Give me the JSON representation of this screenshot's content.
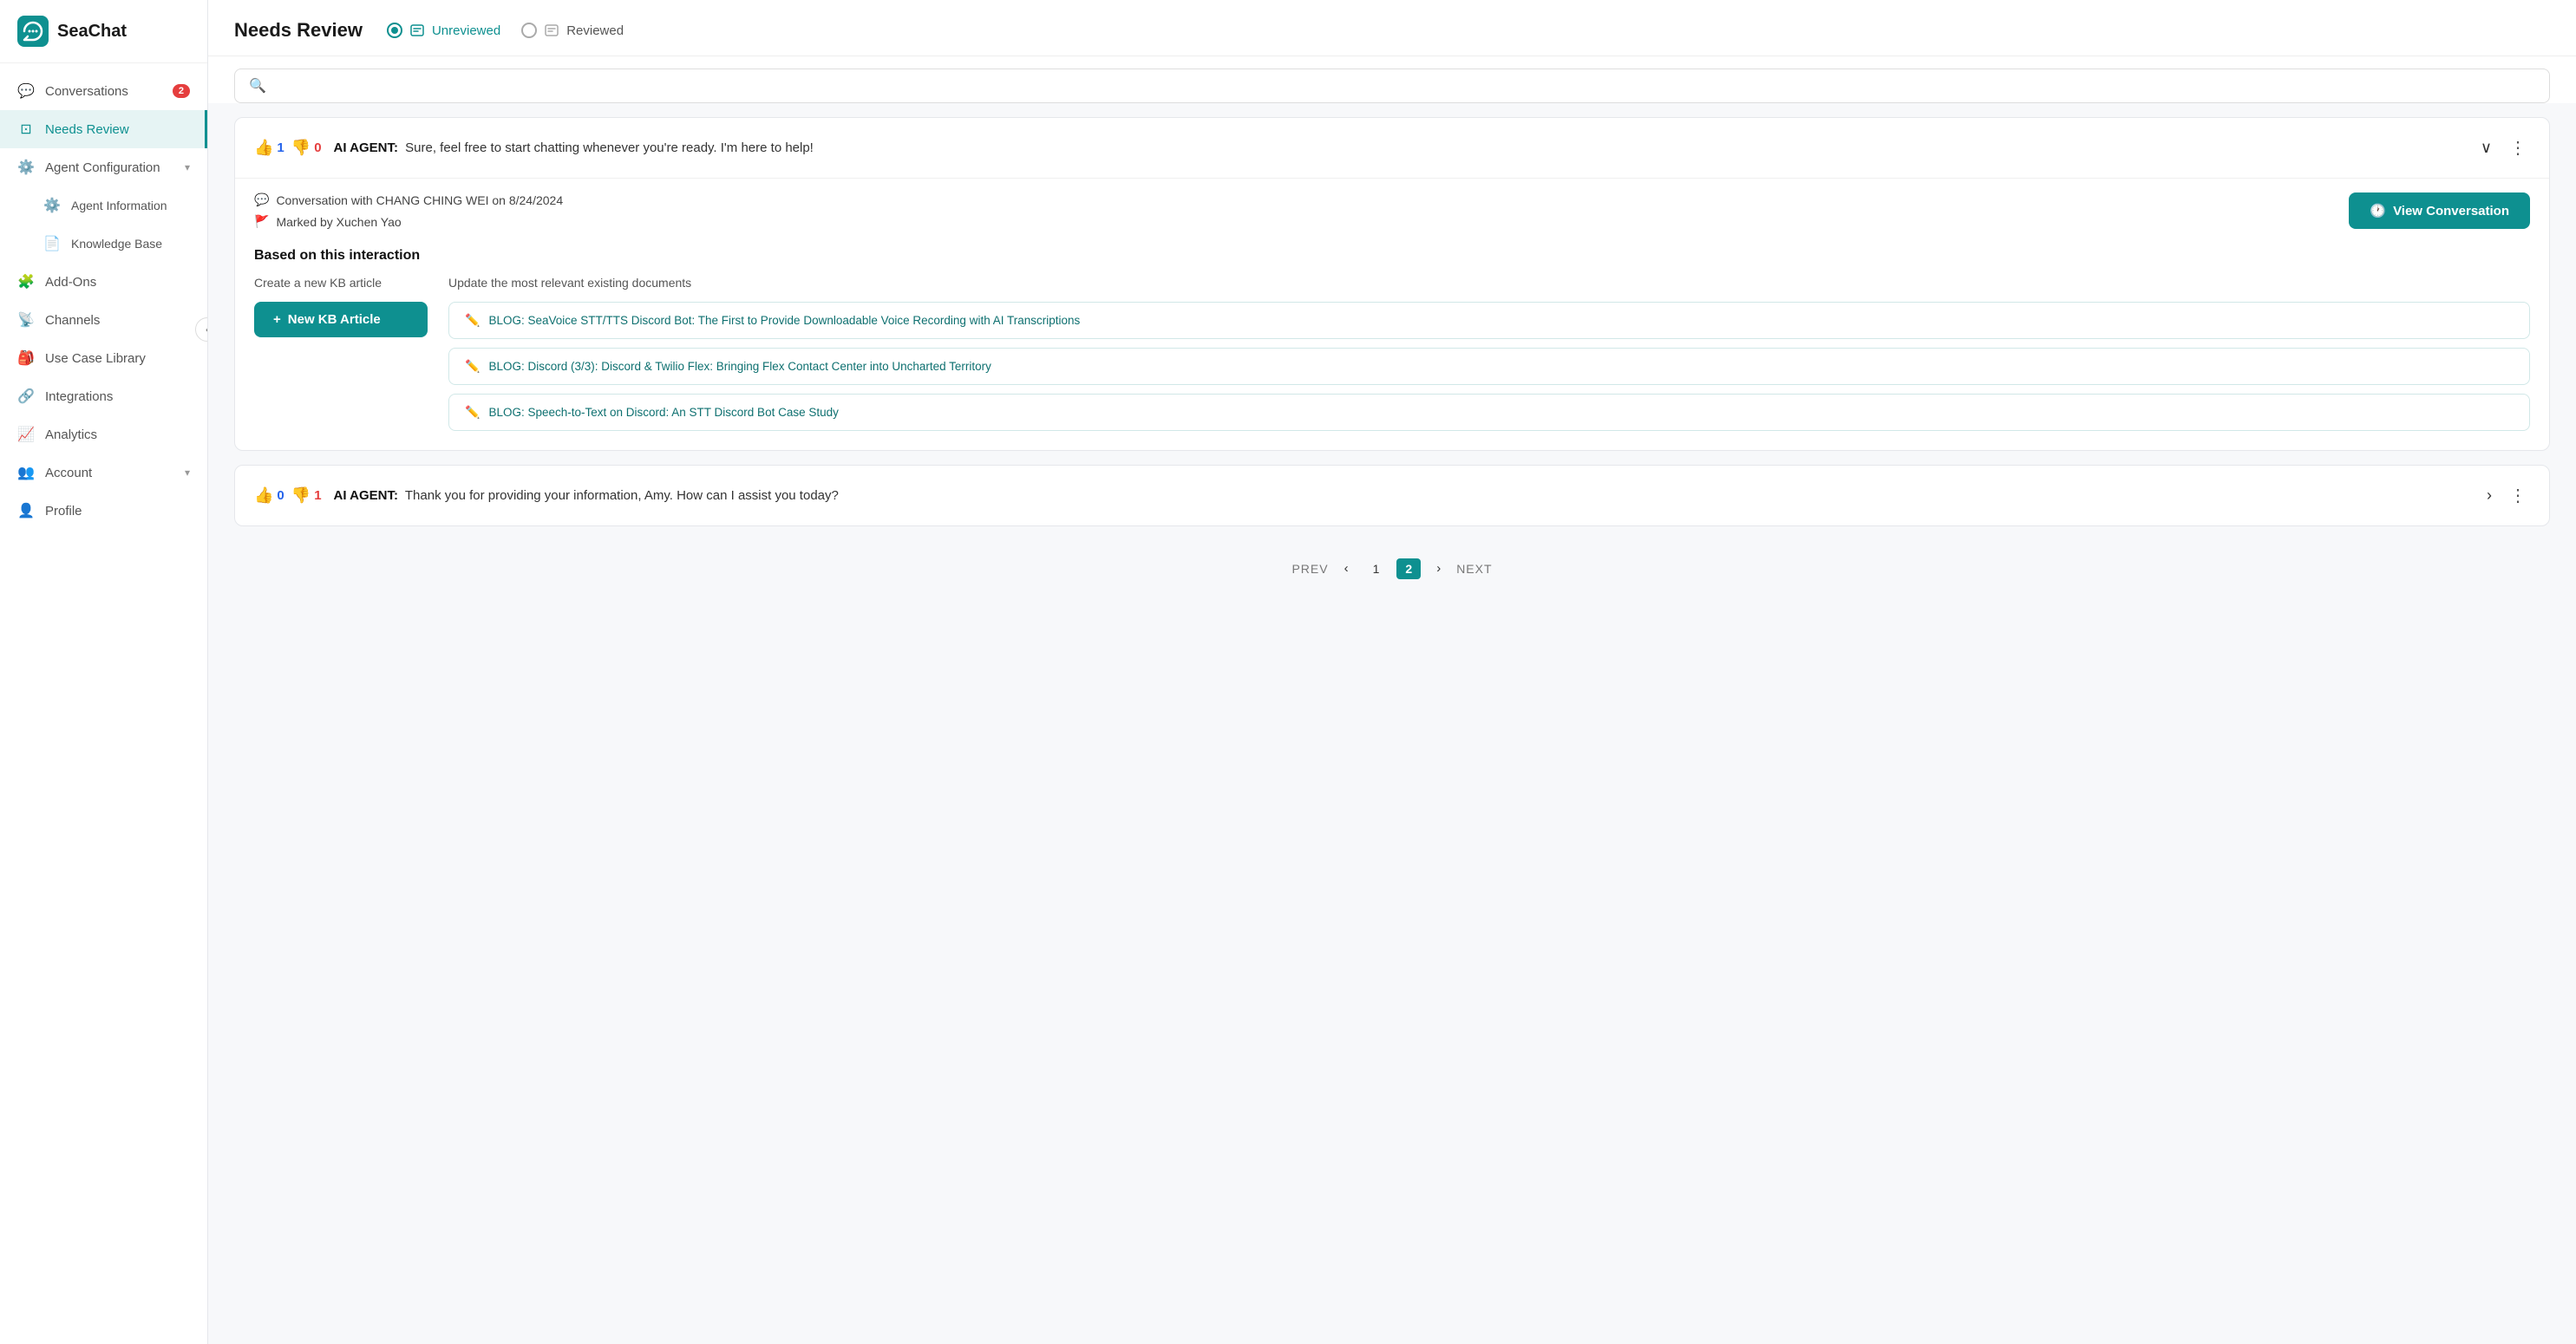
{
  "app": {
    "name": "SeaChat"
  },
  "sidebar": {
    "items": [
      {
        "id": "conversations",
        "label": "Conversations",
        "icon": "💬",
        "badge": "2",
        "active": false
      },
      {
        "id": "needs-review",
        "label": "Needs Review",
        "icon": "📋",
        "badge": null,
        "active": true
      },
      {
        "id": "agent-configuration",
        "label": "Agent Configuration",
        "icon": "⚙️",
        "badge": null,
        "arrow": true,
        "active": false
      },
      {
        "id": "agent-information",
        "label": "Agent Information",
        "icon": "⚙️",
        "badge": null,
        "active": false,
        "sub": true
      },
      {
        "id": "knowledge-base",
        "label": "Knowledge Base",
        "icon": "📄",
        "badge": null,
        "active": false,
        "sub": true
      },
      {
        "id": "add-ons",
        "label": "Add-Ons",
        "icon": "🧩",
        "badge": null,
        "active": false
      },
      {
        "id": "channels",
        "label": "Channels",
        "icon": "📡",
        "badge": null,
        "active": false
      },
      {
        "id": "use-case-library",
        "label": "Use Case Library",
        "icon": "🎒",
        "badge": null,
        "active": false
      },
      {
        "id": "integrations",
        "label": "Integrations",
        "icon": "🔗",
        "badge": null,
        "active": false
      },
      {
        "id": "analytics",
        "label": "Analytics",
        "icon": "📈",
        "badge": null,
        "active": false
      },
      {
        "id": "account",
        "label": "Account",
        "icon": "👥",
        "badge": null,
        "arrow": true,
        "active": false
      },
      {
        "id": "profile",
        "label": "Profile",
        "icon": "👤",
        "badge": null,
        "active": false
      }
    ]
  },
  "header": {
    "title": "Needs Review",
    "tabs": [
      {
        "id": "unreviewed",
        "label": "Unreviewed",
        "active": true,
        "radio": "filled"
      },
      {
        "id": "reviewed",
        "label": "Reviewed",
        "active": false,
        "radio": "empty"
      }
    ]
  },
  "search": {
    "placeholder": ""
  },
  "cards": [
    {
      "id": "card1",
      "thumbUp": "1",
      "thumbDown": "0",
      "agent": "AI AGENT:",
      "message": " Sure, feel free to start chatting whenever you're ready. I'm here to help!",
      "expanded": true,
      "conversation": "Conversation with CHANG CHING WEI on 8/24/2024",
      "markedBy": "Marked by Xuchen Yao",
      "viewBtn": "View Conversation",
      "sectionTitle": "Based on this interaction",
      "createLabel": "Create a new KB article",
      "updateLabel": "Update the most relevant existing documents",
      "newKbBtn": "+ New KB Article",
      "docs": [
        {
          "text": "BLOG: SeaVoice STT/TTS Discord Bot: The First to Provide Downloadable Voice Recording with AI Transcriptions"
        },
        {
          "text": "BLOG: Discord (3/3): Discord & Twilio Flex: Bringing Flex Contact Center into Uncharted Territory"
        },
        {
          "text": "BLOG: Speech-to-Text on Discord: An STT Discord Bot Case Study"
        }
      ]
    },
    {
      "id": "card2",
      "thumbUp": "0",
      "thumbDown": "1",
      "agent": "AI AGENT:",
      "message": " Thank you for providing your information, Amy. How can I assist you today?",
      "expanded": false
    }
  ],
  "pagination": {
    "prev": "PREV",
    "next": "NEXT",
    "pages": [
      "1",
      "2"
    ],
    "current": "2"
  }
}
